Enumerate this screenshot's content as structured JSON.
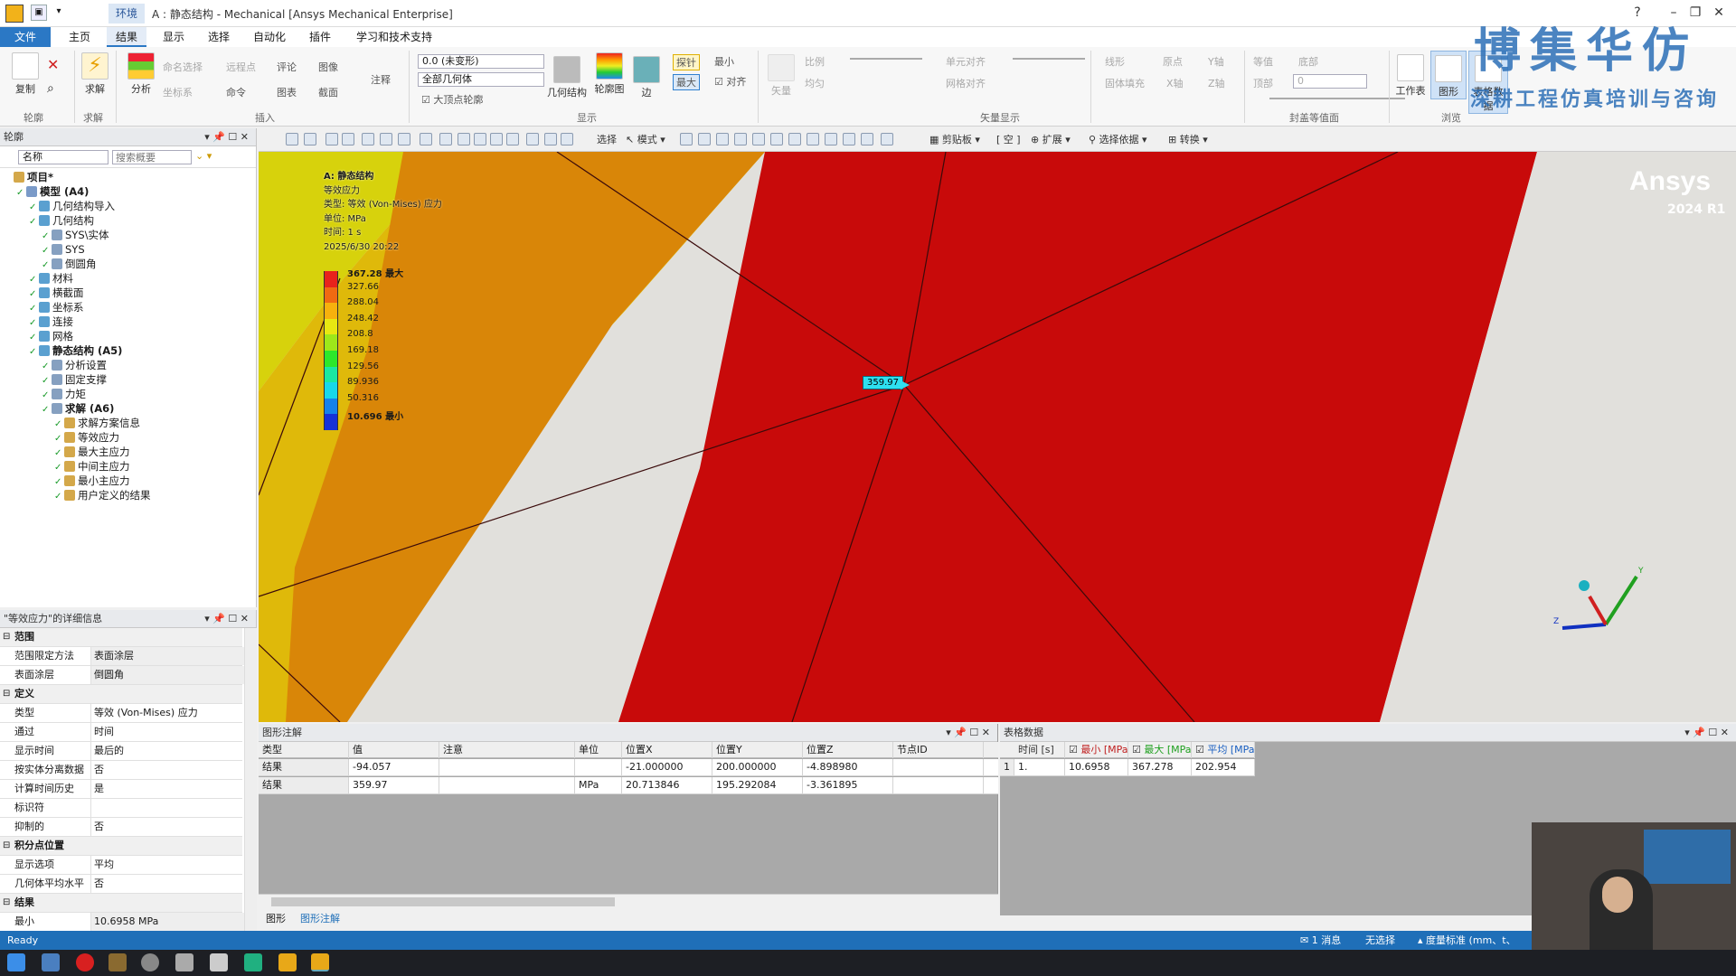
{
  "window": {
    "context_tab": "环境",
    "title": "A : 静态结构 - Mechanical [Ansys Mechanical Enterprise]"
  },
  "menu": [
    "文件",
    "主页",
    "结果",
    "显示",
    "选择",
    "自动化",
    "插件",
    "学习和技术支持"
  ],
  "ribbon": {
    "outline_group": {
      "copy": "复制",
      "label": "轮廓"
    },
    "solve_group": {
      "solve": "求解",
      "label": "求解"
    },
    "analysis": "分析",
    "insert_small": [
      "命名选择",
      "远程点",
      "评论",
      "图像",
      "坐标系",
      "命令",
      "图表",
      "截面",
      "注释"
    ],
    "insert_label": "插入",
    "deform_select": "0.0 (未变形)",
    "geom_select": "全部几何体",
    "max_contour": "大顶点轮廓",
    "display_btns": [
      "几何结构",
      "轮廓图",
      "边"
    ],
    "probe": "探针",
    "maxbtn": "最大",
    "minbtn": "最小",
    "align": "对齐",
    "display_label": "显示",
    "vector": "矢量",
    "ratio": "比例",
    "uniform": "均匀",
    "element_align": "单元对齐",
    "grid_align": "网格对齐",
    "vector_label": "矢量显示",
    "line": "线形",
    "solid_fill": "固体填充",
    "origin": "原点",
    "x_axis": "X轴",
    "y_axis": "Y轴",
    "z_axis": "Z轴",
    "isoline": "等值",
    "top": "顶部",
    "bottom": "底部",
    "cap_value": "0",
    "cap_label": "封盖等值面",
    "worksheet": "工作表",
    "graph": "图形",
    "table_data": "表格数据",
    "browse_label": "浏览"
  },
  "outline": {
    "header": "轮廓",
    "filter_name": "名称",
    "search_placeholder": "搜索概要",
    "items": [
      {
        "label": "项目*",
        "level": 0,
        "bold": true
      },
      {
        "label": "模型 (A4)",
        "level": 1,
        "bold": true
      },
      {
        "label": "几何结构导入",
        "level": 2
      },
      {
        "label": "几何结构",
        "level": 2
      },
      {
        "label": "SYS\\实体",
        "level": 3
      },
      {
        "label": "SYS",
        "level": 3
      },
      {
        "label": "倒圆角",
        "level": 3
      },
      {
        "label": "材料",
        "level": 2
      },
      {
        "label": "横截面",
        "level": 2
      },
      {
        "label": "坐标系",
        "level": 2
      },
      {
        "label": "连接",
        "level": 2
      },
      {
        "label": "网格",
        "level": 2
      },
      {
        "label": "静态结构 (A5)",
        "level": 2,
        "bold": true
      },
      {
        "label": "分析设置",
        "level": 3
      },
      {
        "label": "固定支撑",
        "level": 3
      },
      {
        "label": "力矩",
        "level": 3
      },
      {
        "label": "求解 (A6)",
        "level": 3,
        "bold": true
      },
      {
        "label": "求解方案信息",
        "level": 4
      },
      {
        "label": "等效应力",
        "level": 4
      },
      {
        "label": "最大主应力",
        "level": 4
      },
      {
        "label": "中间主应力",
        "level": 4
      },
      {
        "label": "最小主应力",
        "level": 4
      },
      {
        "label": "用户定义的结果",
        "level": 4
      }
    ]
  },
  "details": {
    "header": "\"等效应力\"的详细信息",
    "rows": [
      {
        "key": "范围",
        "section": true
      },
      {
        "key": "范围限定方法",
        "value": "表面涂层",
        "gray": true
      },
      {
        "key": "表面涂层",
        "value": "倒圆角",
        "gray": true
      },
      {
        "key": "定义",
        "section": true
      },
      {
        "key": "类型",
        "value": "等效 (Von-Mises) 应力"
      },
      {
        "key": "通过",
        "value": "时间"
      },
      {
        "key": "显示时间",
        "value": "最后的"
      },
      {
        "key": "按实体分离数据",
        "value": "否"
      },
      {
        "key": "计算时间历史",
        "value": "是"
      },
      {
        "key": "标识符",
        "value": ""
      },
      {
        "key": "抑制的",
        "value": "否"
      },
      {
        "key": "积分点位置",
        "section": true
      },
      {
        "key": "显示选项",
        "value": "平均"
      },
      {
        "key": "几何体平均水平",
        "value": "否"
      },
      {
        "key": "结果",
        "section": true
      },
      {
        "key": "最小",
        "value": "10.6958 MPa",
        "gray": true
      }
    ]
  },
  "graphics_toolbar": [
    "选择",
    "模式",
    "剪贴板",
    "[ 空 ]",
    "扩展",
    "选择依据",
    "转换"
  ],
  "viewport": {
    "info": [
      "A: 静态结构",
      "等效应力",
      "类型: 等效 (Von-Mises) 应力",
      "单位: MPa",
      "时间: 1 s",
      "2025/6/30 20:22"
    ],
    "legend": [
      {
        "value": "367.28 最大",
        "color": "#e8231c"
      },
      {
        "value": "327.66",
        "color": "#f06a12"
      },
      {
        "value": "288.04",
        "color": "#f7b10d"
      },
      {
        "value": "248.42",
        "color": "#e8e812"
      },
      {
        "value": "208.8",
        "color": "#9de81a"
      },
      {
        "value": "169.18",
        "color": "#2ce82b"
      },
      {
        "value": "129.56",
        "color": "#1ae8a2"
      },
      {
        "value": "89.936",
        "color": "#17d8ea"
      },
      {
        "value": "50.316",
        "color": "#1682ea"
      },
      {
        "value": "10.696 最小",
        "color": "#1632d8"
      }
    ],
    "probe_label": "359.97",
    "brand": "Ansys",
    "version": "2024 R1",
    "axis_y": "Y",
    "axis_z": "Z"
  },
  "annotation": {
    "header": "图形注解",
    "columns": [
      "类型",
      "值",
      "注意",
      "单位",
      "位置X",
      "位置Y",
      "位置Z",
      "节点ID"
    ],
    "rows": [
      [
        "结果",
        "-94.057",
        "",
        "",
        "-21.000000",
        "200.000000",
        "-4.898980",
        ""
      ],
      [
        "结果",
        "359.97",
        "",
        "MPa",
        "20.713846",
        "195.292084",
        "-3.361895",
        ""
      ]
    ],
    "tabs": [
      "图形",
      "图形注解"
    ]
  },
  "table_data": {
    "header": "表格数据",
    "columns": [
      "时间 [s]",
      "最小 [MPa]",
      "最大 [MPa]",
      "平均 [MPa]"
    ],
    "rows": [
      [
        "1",
        "1.",
        "10.6958",
        "367.278",
        "202.954"
      ]
    ]
  },
  "statusbar": {
    "left": "Ready",
    "messages": "1 消息",
    "selection": "无选择",
    "units": "度量标准 (mm、t、"
  },
  "watermark": {
    "line1": "博集华仿",
    "line2": "深耕工程仿真培训与咨询"
  }
}
